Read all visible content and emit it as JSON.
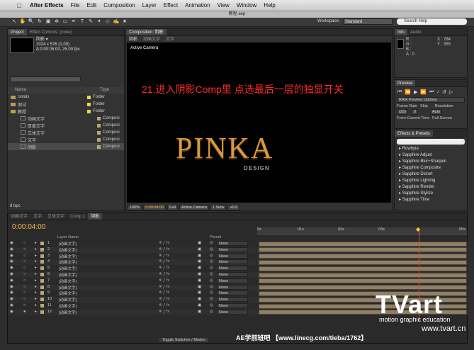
{
  "menubar": {
    "app": "After Effects",
    "items": [
      "File",
      "Edit",
      "Composition",
      "Layer",
      "Effect",
      "Animation",
      "View",
      "Window",
      "Help"
    ]
  },
  "window_title": "教程.aep",
  "toolbar": {
    "workspace_label": "Workspace:",
    "workspace_value": "Standard",
    "search_placeholder": "Search Help"
  },
  "project": {
    "tab": "Project",
    "tab2": "Effect Controls: (none)",
    "item_name": "阴影 ▾",
    "item_size": "1024 x 576 (1.00)",
    "item_duration": "Δ 0:00:05:00, 25.00 fps",
    "col_name": "Name",
    "col_type": "Type",
    "rows": [
      {
        "name": "Solids",
        "type": "Folder",
        "kind": "folder",
        "color": "#e8d84a"
      },
      {
        "name": "测试",
        "type": "Folder",
        "kind": "folder",
        "color": "#e8d84a"
      },
      {
        "name": "教程",
        "type": "Folder",
        "kind": "folder",
        "color": "#e8d84a"
      },
      {
        "name": "动画文字",
        "type": "Composi",
        "kind": "comp",
        "color": "#b8a878"
      },
      {
        "name": "厚度文字",
        "type": "Composi",
        "kind": "comp",
        "color": "#b8a878"
      },
      {
        "name": "立体文字",
        "type": "Composi",
        "kind": "comp",
        "color": "#b8a878"
      },
      {
        "name": "文字",
        "type": "Composi",
        "kind": "comp",
        "color": "#b8a878"
      },
      {
        "name": "阴影",
        "type": "Composi",
        "kind": "comp",
        "color": "#b8a878"
      }
    ],
    "bpc": "8 bpc"
  },
  "composition": {
    "tab": "Composition: 阴影",
    "crumbs": [
      "阴影",
      "动画文字",
      "文字"
    ],
    "active_camera": "Active Camera",
    "instruction": "21.进入阴影Comp里 点选最后一层的独显开关",
    "logo_main": "PINKA",
    "logo_sub": "DESIGN",
    "footer": {
      "zoom": "100%",
      "timecode": "0:00:04:00",
      "quality": "Full",
      "camera": "Active Camera",
      "view": "1 View",
      "offset": "+0.0"
    }
  },
  "info": {
    "tab": "Info",
    "tab2": "Audio",
    "r": "R :",
    "g": "G :",
    "b": "B :",
    "a": "A : 0",
    "x": "X : 784",
    "y": "Y : 355"
  },
  "preview": {
    "tab": "Preview",
    "ram": "RAM Preview Options",
    "frame_rate_label": "Frame Rate",
    "skip_label": "Skip",
    "resolution_label": "Resolution",
    "frame_rate": "(25)",
    "skip": "0",
    "resolution": "Auto",
    "from_current": "From Current Time",
    "full_screen": "Full Screen"
  },
  "effects": {
    "tab": "Effects & Presets",
    "items": [
      "Rowbyte",
      "Sapphire Adjust",
      "Sapphire Blur+Sharpen",
      "Sapphire Composite",
      "Sapphire Distort",
      "Sapphire Lighting",
      "Sapphire Render",
      "Sapphire Stylize",
      "Sapphire Time"
    ]
  },
  "timeline": {
    "tabs": [
      "动画文字",
      "文字",
      "立体文字",
      "Comp 1",
      "阴影"
    ],
    "timecode": "0:00:04:00",
    "col_layer_name": "Layer Name",
    "col_parent": "Parent",
    "ruler": [
      "0s",
      "01s",
      "02s",
      "03s",
      "",
      "05s"
    ],
    "layers": [
      {
        "num": "1",
        "name": "[动画文字]",
        "parent": "None"
      },
      {
        "num": "2",
        "name": "[动画文字]",
        "parent": "None"
      },
      {
        "num": "3",
        "name": "[动画文字]",
        "parent": "None"
      },
      {
        "num": "4",
        "name": "[动画文字]",
        "parent": "None"
      },
      {
        "num": "5",
        "name": "[动画文字]",
        "parent": "None"
      },
      {
        "num": "6",
        "name": "[动画文字]",
        "parent": "None"
      },
      {
        "num": "7",
        "name": "[动画文字]",
        "parent": "None"
      },
      {
        "num": "8",
        "name": "[动画文字]",
        "parent": "None"
      },
      {
        "num": "9",
        "name": "[动画文字]",
        "parent": "None"
      },
      {
        "num": "10",
        "name": "[动画文字]",
        "parent": "None"
      },
      {
        "num": "11",
        "name": "[动画文字]",
        "parent": "None"
      },
      {
        "num": "12",
        "name": "[动画文字]",
        "parent": "None"
      }
    ],
    "toggle_label": "Toggle Switches / Modes"
  },
  "watermark": {
    "brand": "TVart",
    "tagline": "motion graphic education",
    "url": "www.tvart.cn"
  },
  "footer_caption": "AE学前班吧 【www.linecg.com/tieba/1762】"
}
